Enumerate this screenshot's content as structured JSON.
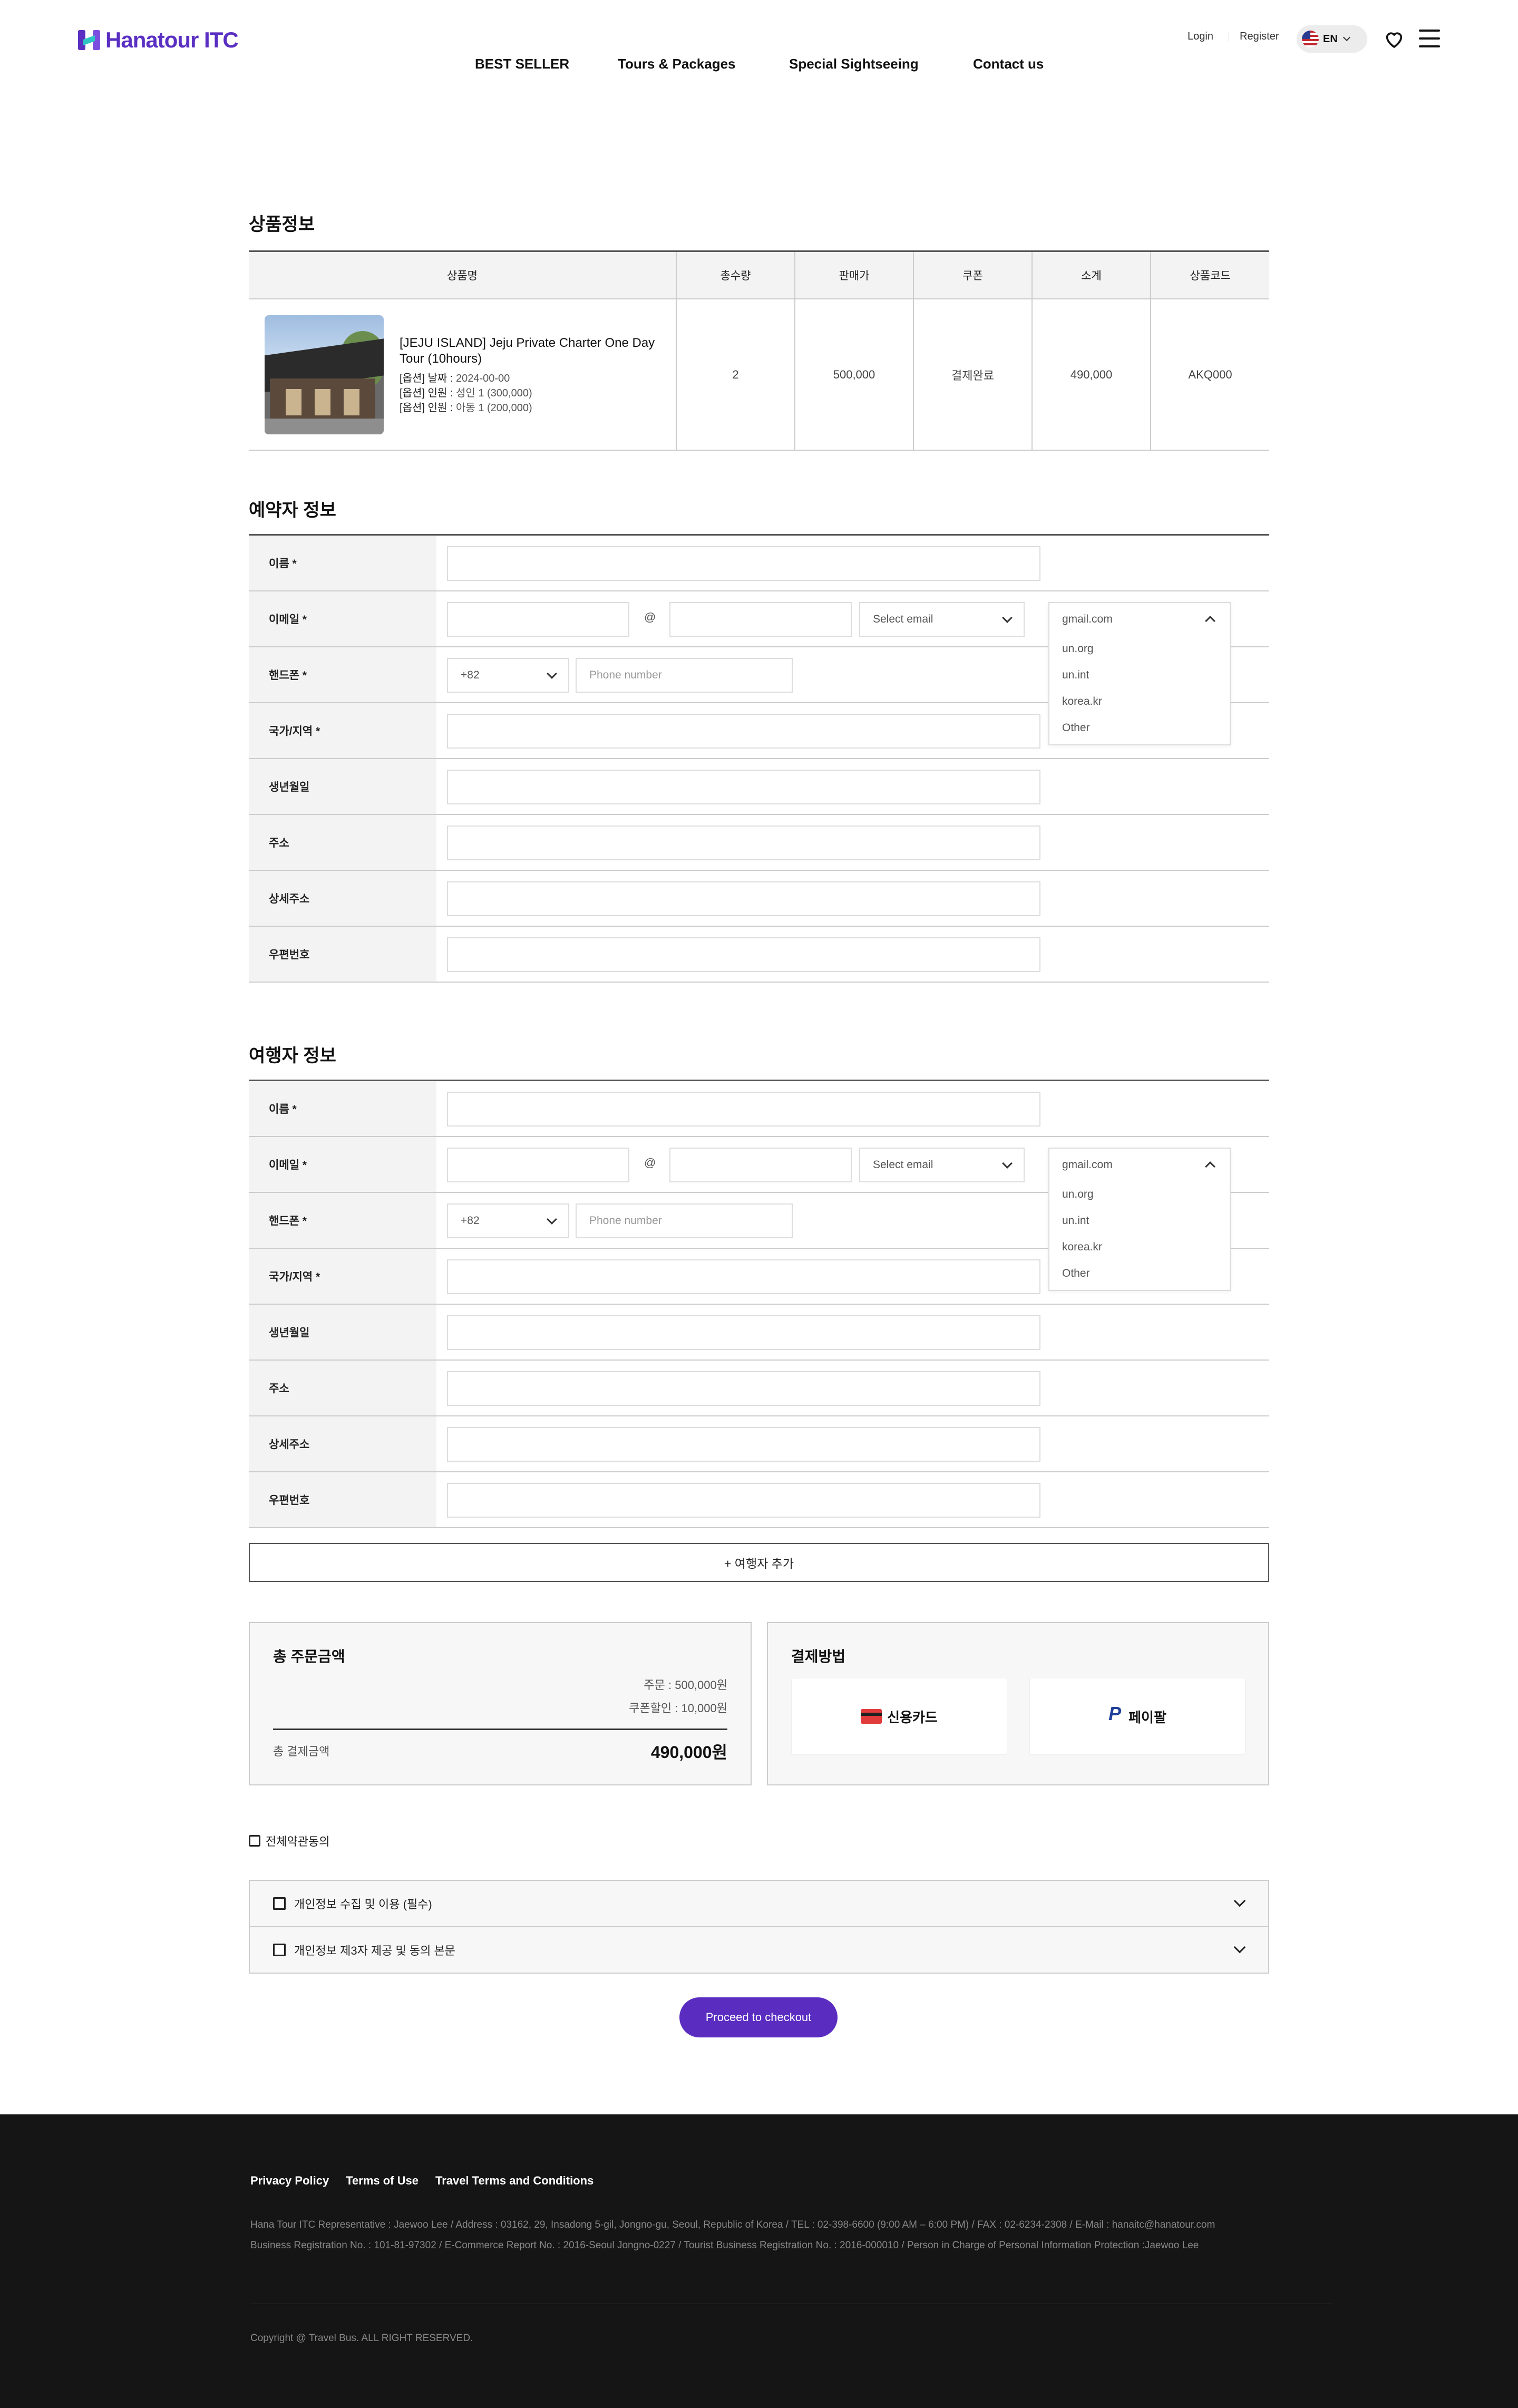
{
  "header": {
    "logo_text": "Hanatour ITC",
    "nav": [
      "BEST SELLER",
      "Tours & Packages",
      "Special Sightseeing",
      "Contact us"
    ],
    "login": "Login",
    "register": "Register",
    "lang": "EN"
  },
  "product": {
    "section_title": "상품정보",
    "columns": [
      "상품명",
      "총수량",
      "판매가",
      "쿠폰",
      "소계",
      "상품코드"
    ],
    "name": "[JEJU ISLAND] Jeju Private Charter One Day Tour (10hours)",
    "options": [
      {
        "label": "[옵션] 날짜 :",
        "value": "2024-00-00"
      },
      {
        "label": "[옵션] 인원 :",
        "value": "성인 1 (300,000)"
      },
      {
        "label": "[옵션] 인원 :",
        "value": "아동 1 (200,000)"
      }
    ],
    "quantity": "2",
    "price": "500,000",
    "coupon": "결제완료",
    "subtotal": "490,000",
    "code": "AKQ000"
  },
  "booker": {
    "section_title": "예약자 정보",
    "labels": [
      "이름 *",
      "이메일 *",
      "핸드폰 *",
      "국가/지역 *",
      "생년월일",
      "주소",
      "상세주소",
      "우편번호"
    ],
    "at": "@",
    "email_select": "Select email",
    "phone_code": "+82",
    "phone_placeholder": "Phone number",
    "dropdown_selected": "gmail.com",
    "dropdown_options": [
      "un.org",
      "un.int",
      "korea.kr",
      "Other"
    ]
  },
  "traveler": {
    "section_title": "여행자 정보",
    "labels": [
      "이름 *",
      "이메일 *",
      "핸드폰 *",
      "국가/지역 *",
      "생년월일",
      "주소",
      "상세주소",
      "우편번호"
    ],
    "at": "@",
    "email_select": "Select email",
    "phone_code": "+82",
    "phone_placeholder": "Phone number",
    "dropdown_selected": "gmail.com",
    "dropdown_options": [
      "un.org",
      "un.int",
      "korea.kr",
      "Other"
    ],
    "add_button": "+ 여행자 추가"
  },
  "summary": {
    "title": "총 주문금액",
    "order": "주문 : 500,000원",
    "coupon_discount": "쿠폰할인 : 10,000원",
    "total_label": "총 결제금액",
    "total": "490,000원"
  },
  "payment": {
    "title": "결제방법",
    "card": "신용카드",
    "paypal": "페이팔",
    "card_color": "#e23b3b",
    "paypal_color": "#1f3f9a"
  },
  "agreements": {
    "all": "전체약관동의",
    "items": [
      "개인정보 수집 및 이용 (필수)",
      "개인정보 제3자 제공 및 동의 본문"
    ]
  },
  "checkout_label": "Proceed to checkout",
  "accent_color": "#5a2cc0",
  "footer": {
    "links": [
      "Privacy Policy",
      "Terms of Use",
      "Travel Terms and Conditions"
    ],
    "info_line1": "Hana Tour ITC Representative : Jaewoo Lee / Address : 03162, 29, Insadong 5-gil, Jongno-gu, Seoul, Republic of Korea / TEL : 02-398-6600 (9:00 AM – 6:00 PM) / FAX : 02-6234-2308 / E-Mail : hanaitc@hanatour.com",
    "info_line2": "Business Registration No. : 101-81-97302 / E-Commerce Report No. : 2016-Seoul Jongno-0227 / Tourist Business Registration No. : 2016-000010 / Person in Charge of Personal Information Protection :Jaewoo Lee",
    "copyright": "Copyright @ Travel Bus. ALL RIGHT RESERVED."
  }
}
